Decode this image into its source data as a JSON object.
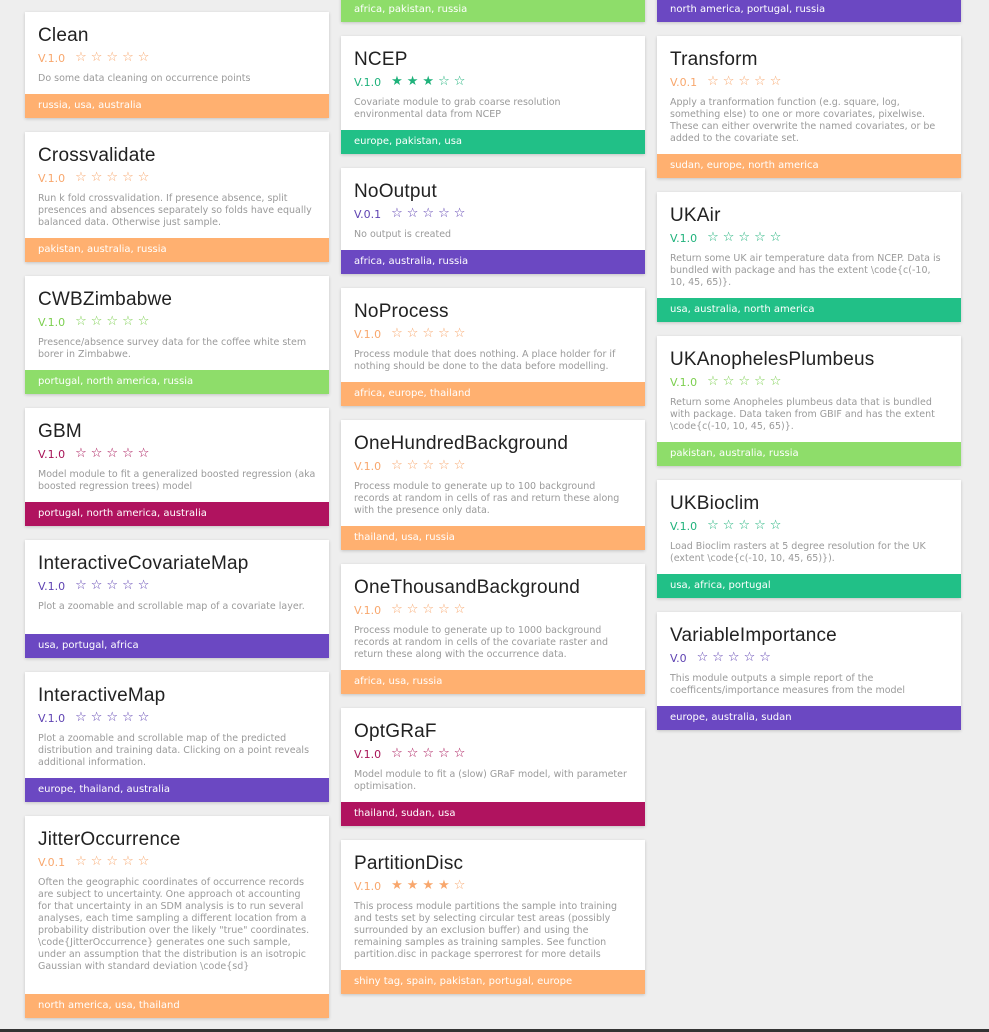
{
  "colors": {
    "orange": "#ffb070",
    "lightgreen": "#8edd6a",
    "teal": "#21c087",
    "purple": "#6b48c2",
    "magenta": "#b0135f",
    "ver_orange": "#f8a76d",
    "ver_green": "#7ccf4f",
    "ver_teal": "#1fb27b",
    "ver_purple": "#5f43b2",
    "ver_magenta": "#a81357"
  },
  "columns": [
    {
      "top_partial": null,
      "cards": [
        {
          "name": "Clean",
          "version": "V.1.0",
          "rating": 0,
          "color": "orange",
          "desc": "Do some data cleaning on occurrence points",
          "tags": "russia, usa, australia"
        },
        {
          "name": "Crossvalidate",
          "version": "V.1.0",
          "rating": 0,
          "color": "orange",
          "desc": "Run k fold crossvalidation. If presence absence, split presences and absences separately so folds have equally balanced data. Otherwise just sample.",
          "tags": "pakistan, australia, russia"
        },
        {
          "name": "CWBZimbabwe",
          "version": "V.1.0",
          "rating": 0,
          "color": "lightgreen",
          "desc": "Presence/absence survey data for the coffee white stem borer in Zimbabwe.",
          "tags": "portugal, north america, russia"
        },
        {
          "name": "GBM",
          "version": "V.1.0",
          "rating": 0,
          "color": "magenta",
          "desc": "Model module to fit a generalized boosted regression (aka boosted regression trees) model",
          "tags": "portugal, north america, australia"
        },
        {
          "name": "InteractiveCovariateMap",
          "version": "V.1.0",
          "rating": 0,
          "color": "purple",
          "desc": "Plot a zoomable and scrollable map of a covariate layer.",
          "tags": "usa, portugal, africa"
        },
        {
          "name": "InteractiveMap",
          "version": "V.1.0",
          "rating": 0,
          "color": "purple",
          "desc": "Plot a zoomable and scrollable map of the predicted distribution and training data. Clicking on a point reveals additional information.",
          "tags": "europe, thailand, australia"
        },
        {
          "name": "JitterOccurrence",
          "version": "V.0.1",
          "rating": 0,
          "color": "orange",
          "desc": "Often the geographic coordinates of occurrence records are subject to uncertainty. One approach ot accounting for that uncertainty in an SDM analysis is to run several analyses, each time sampling a different location from a probability distribution over the likely \"true\" coordinates. \\code{JitterOccurrence} generates one such sample, under an assumption that the distribution is an isotropic Gaussian with standard deviation \\code{sd}",
          "tags": "north america, usa, thailand"
        }
      ]
    },
    {
      "top_partial": {
        "color": "lightgreen",
        "tags": "africa, pakistan, russia"
      },
      "cards": [
        {
          "name": "NCEP",
          "version": "V.1.0",
          "rating": 3,
          "color": "teal",
          "desc": "Covariate module to grab coarse resolution environmental data from NCEP",
          "tags": "europe, pakistan, usa"
        },
        {
          "name": "NoOutput",
          "version": "V.0.1",
          "rating": 0,
          "color": "purple",
          "desc": "No output is created",
          "tags": "africa, australia, russia"
        },
        {
          "name": "NoProcess",
          "version": "V.1.0",
          "rating": 0,
          "color": "orange",
          "desc": "Process module that does nothing. A place holder for if nothing should be done to the data before modelling.",
          "tags": "africa, europe, thailand"
        },
        {
          "name": "OneHundredBackground",
          "version": "V.1.0",
          "rating": 0,
          "color": "orange",
          "desc": "Process module to generate up to 100 background records at random in cells of ras and return these along with the presence only data.",
          "tags": "thailand, usa, russia"
        },
        {
          "name": "OneThousandBackground",
          "version": "V.1.0",
          "rating": 0,
          "color": "orange",
          "desc": "Process module to generate up to 1000 background records at random in cells of the covariate raster and return these along with the occurrence data.",
          "tags": "africa, usa, russia"
        },
        {
          "name": "OptGRaF",
          "version": "V.1.0",
          "rating": 0,
          "color": "magenta",
          "desc": "Model module to fit a (slow) GRaF model, with parameter optimisation.",
          "tags": "thailand, sudan, usa"
        },
        {
          "name": "PartitionDisc",
          "version": "V.1.0",
          "rating": 4,
          "color": "orange",
          "desc": "This process module partitions the sample into training and tests set by selecting circular test areas (possibly surrounded by an exclusion buffer) and using the remaining samples as training samples. See function partition.disc in package sperrorest for more details",
          "tags": "shiny tag, spain, pakistan, portugal, europe"
        }
      ]
    },
    {
      "top_partial": {
        "color": "purple",
        "tags": "north america, portugal, russia"
      },
      "cards": [
        {
          "name": "Transform",
          "version": "V.0.1",
          "rating": 0,
          "color": "orange",
          "desc": "Apply a tranformation function (e.g. square, log, something else) to one or more covariates, pixelwise. These can either overwrite the named covariates, or be added to the covariate set.",
          "tags": "sudan, europe, north america"
        },
        {
          "name": "UKAir",
          "version": "V.1.0",
          "rating": 0,
          "color": "teal",
          "desc": "Return some UK air temperature data from NCEP. Data is bundled with package and has the extent \\code{c(-10, 10, 45, 65)}.",
          "tags": "usa, australia, north america"
        },
        {
          "name": "UKAnophelesPlumbeus",
          "version": "V.1.0",
          "rating": 0,
          "color": "lightgreen",
          "desc": "Return some Anopheles plumbeus data that is bundled with package. Data taken from GBIF and has the extent \\code{c(-10, 10, 45, 65)}.",
          "tags": "pakistan, australia, russia"
        },
        {
          "name": "UKBioclim",
          "version": "V.1.0",
          "rating": 0,
          "color": "teal",
          "desc": "Load Bioclim rasters at 5 degree resolution for the UK (extent \\code{c(-10, 10, 45, 65)}).",
          "tags": "usa, africa, portugal"
        },
        {
          "name": "VariableImportance",
          "version": "V.0",
          "rating": 0,
          "color": "purple",
          "desc": "This module outputs a simple report of the coefficents/importance measures from the model",
          "tags": "europe, australia, sudan"
        }
      ]
    }
  ]
}
